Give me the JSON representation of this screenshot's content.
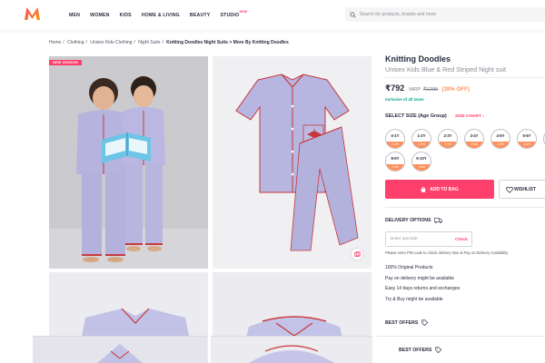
{
  "header": {
    "nav": [
      "MEN",
      "WOMEN",
      "KIDS",
      "HOME & LIVING",
      "BEAUTY",
      "STUDIO"
    ],
    "studio_badge": "NEW",
    "search_placeholder": "Search for products, brands and more"
  },
  "breadcrumb": {
    "items": [
      "Home",
      "Clothing",
      "Unisex Kids Clothing",
      "Night Suits"
    ],
    "current": "Knitting Doodles Night Suits > More By Knitting Doodles"
  },
  "gallery": {
    "badge": "NEW SEASON"
  },
  "product": {
    "brand": "Knitting Doodles",
    "name": "Unisex Kids Blue & Red Striped Night suit",
    "price": "₹792",
    "mrp_label": "MRP",
    "mrp": "₹1299",
    "discount": "(39% OFF)",
    "taxes": "inclusive of all taxes"
  },
  "sizes": {
    "heading": "SELECT SIZE (Age Group)",
    "chart_link": "SIZE CHART",
    "options": [
      {
        "label": "0-1Y",
        "left": "2 left"
      },
      {
        "label": "1-2Y",
        "left": "2 left"
      },
      {
        "label": "2-3Y",
        "left": "3 left"
      },
      {
        "label": "3-4Y",
        "left": "3 left"
      },
      {
        "label": "4-5Y",
        "left": "4 left"
      },
      {
        "label": "5-6Y",
        "left": "4 left"
      },
      {
        "label": "8-9Y",
        "left": "2 left"
      },
      {
        "label": "9-10Y",
        "left": "1 left"
      }
    ]
  },
  "actions": {
    "add_to_bag": "ADD TO BAG",
    "wishlist": "WISHLIST"
  },
  "delivery": {
    "heading": "DELIVERY OPTIONS",
    "pincode_placeholder": "Enter pincode",
    "check": "Check",
    "note": "Please enter PIN code to check delivery time & Pay on Delivery Availability",
    "bullets": [
      "100% Original Products",
      "Pay on delivery might be available",
      "Easy 14 days returns and exchanges",
      "Try & Buy might be available"
    ]
  },
  "offers": {
    "heading": "BEST OFFERS",
    "heading_repeat": "BEST OFFERS"
  },
  "colors": {
    "accent": "#ff3f6c",
    "discount": "#ff905a",
    "taxes": "#03a685",
    "pajama": "#b9b8e0",
    "piping": "#d2373b"
  }
}
